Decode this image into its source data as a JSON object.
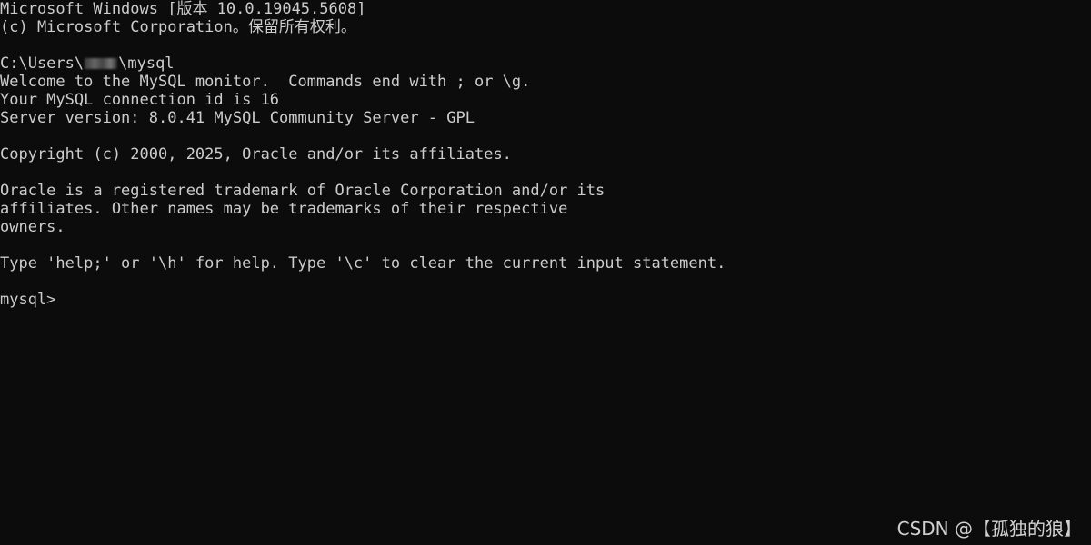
{
  "console": {
    "lines": [
      "Microsoft Windows [版本 10.0.19045.5608]",
      "(c) Microsoft Corporation。保留所有权利。",
      "",
      "",
      "Welcome to the MySQL monitor.  Commands end with ; or \\g.",
      "Your MySQL connection id is 16",
      "Server version: 8.0.41 MySQL Community Server - GPL",
      "",
      "Copyright (c) 2000, 2025, Oracle and/or its affiliates.",
      "",
      "Oracle is a registered trademark of Oracle Corporation and/or its",
      "affiliates. Other names may be trademarks of their respective",
      "owners.",
      "",
      "Type 'help;' or '\\h' for help. Type '\\c' to clear the current input statement.",
      "",
      "mysql>"
    ],
    "path_prefix": "C:\\Users\\",
    "path_suffix": "\\mysql"
  },
  "watermark": {
    "text": "CSDN @【孤独的狼】"
  },
  "colors": {
    "background": "#0c0c0c",
    "text": "#cccccc"
  }
}
